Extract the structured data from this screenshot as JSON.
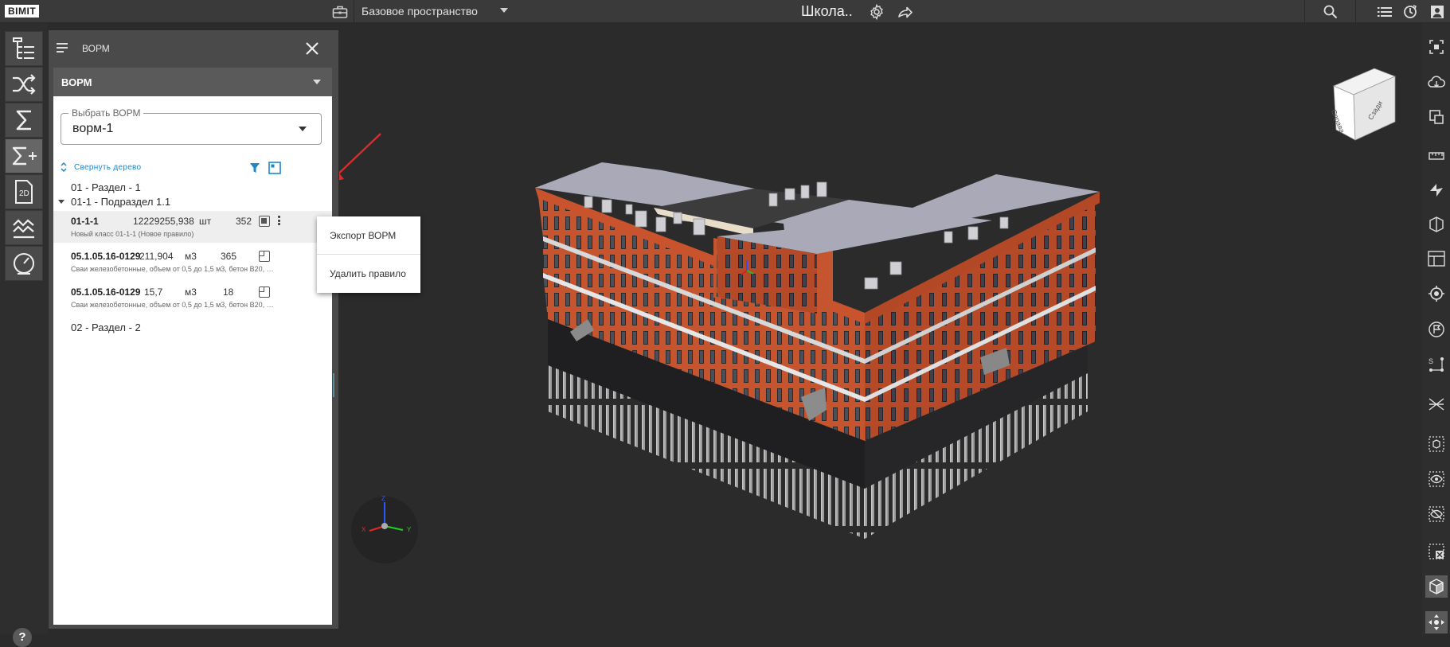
{
  "app": {
    "logo": "BIMIT",
    "space_selector": "Базовое пространство",
    "project_title": "Школа.."
  },
  "panel": {
    "title": "ВОРМ",
    "section_label": "ВОРМ",
    "select": {
      "legend": "Выбрать ВОРМ",
      "value": "ворм-1"
    },
    "collapse_label": "Свернуть дерево",
    "tree": {
      "section1": "01 - Раздел - 1",
      "subsection": "01-1 - Подраздел 1.1",
      "section2": "02 - Раздел - 2",
      "rows": [
        {
          "code": "01-1-1",
          "value": "12229255,938",
          "unit": "шт",
          "count": "352",
          "desc": "Новый класс 01-1-1 (Новое правило)"
        },
        {
          "code": "05.1.05.16-0129",
          "value": "211,904",
          "unit": "м3",
          "count": "365",
          "desc": "Сваи железобетонные, объем от 0,5 до 1,5 м3, бетон B20, ра..."
        },
        {
          "code": "05.1.05.16-0129",
          "value": "15,7",
          "unit": "м3",
          "count": "18",
          "desc": "Сваи железобетонные, объем от 0,5 до 1,5 м3, бетон B20, ра..."
        }
      ]
    }
  },
  "context_menu": {
    "export": "Экспорт ВОРМ",
    "delete": "Удалить правило"
  },
  "view_cube": {
    "face_left": "Справа",
    "face_right": "Сзади"
  },
  "axes": {
    "x": "X",
    "y": "Y",
    "z": "Z"
  },
  "help_label": "?",
  "colors": {
    "accent": "#1e88c7",
    "brick": "#c0502e",
    "roof": "#a8a8b6",
    "annotation_arrow": "#d32f2f"
  }
}
